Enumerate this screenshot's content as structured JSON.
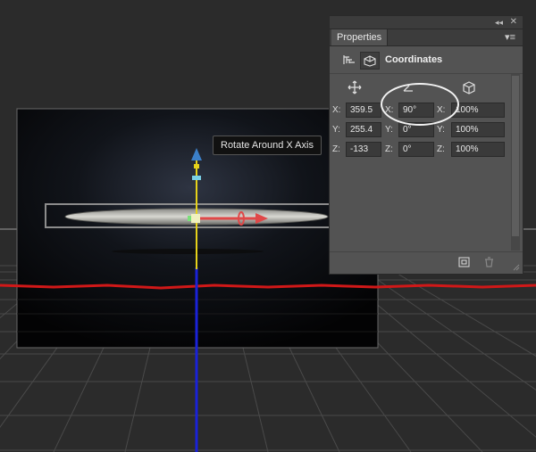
{
  "tooltip": {
    "text": "Rotate Around X Axis"
  },
  "panel": {
    "tab_label": "Properties",
    "header_title": "Coordinates",
    "icons": {
      "collapse": "collapse-icon",
      "close": "close-icon",
      "menu": "panel-menu-icon",
      "mesh": "mesh-icon",
      "coordinates": "coordinates-icon",
      "move": "move-icon",
      "rotate": "rotate-icon",
      "scale": "scale-icon",
      "reset": "reset-coordinates-icon",
      "trash": "trash-icon"
    },
    "rows": [
      {
        "pos_label": "X:",
        "pos_value": "359.5",
        "rot_label": "X:",
        "rot_value": "90°",
        "scale_label": "X:",
        "scale_value": "100%"
      },
      {
        "pos_label": "Y:",
        "pos_value": "255.4",
        "rot_label": "Y:",
        "rot_value": "0°",
        "scale_label": "Y:",
        "scale_value": "100%"
      },
      {
        "pos_label": "Z:",
        "pos_value": "-133",
        "rot_label": "Z:",
        "rot_value": "0°",
        "scale_label": "Z:",
        "scale_value": "100%"
      }
    ]
  },
  "colors": {
    "workspace": "#2b2b2b",
    "panel": "#535353",
    "x_axis": "#e04848",
    "y_axis": "#e6d21a",
    "z_axis": "#1a22d8",
    "grid_line": "#d01818"
  }
}
